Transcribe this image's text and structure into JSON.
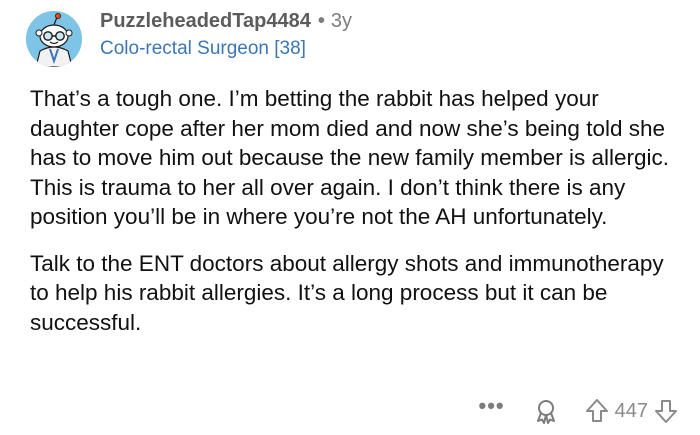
{
  "comment": {
    "username": "PuzzleheadedTap4484",
    "separator": "•",
    "age": "3y",
    "flair": "Colo-rectal Surgeon [38]",
    "paragraphs": [
      "That’s a tough one. I’m betting the rabbit has helped your daughter cope after her mom died and now she’s being told she has to move him out because the new family member is allergic. This is trauma to her all over again. I don’t think there is any position you’ll be in where you’re not the AH unfortunately.",
      "Talk to the ENT doctors about allergy shots and immunotherapy to help his rabbit allergies. It’s a long process but it can be successful."
    ],
    "actions": {
      "more_label": "•••",
      "score": "447"
    }
  },
  "icons": {
    "avatar": "snoo-avatar-icon",
    "award": "award-icon",
    "upvote": "upvote-arrow-icon",
    "downvote": "downvote-arrow-icon"
  },
  "colors": {
    "username": "#5c5c5c",
    "flair": "#3b76b8",
    "body_text": "#111111",
    "muted": "#8a8a8a",
    "avatar_bg": "#7ec4e6"
  }
}
